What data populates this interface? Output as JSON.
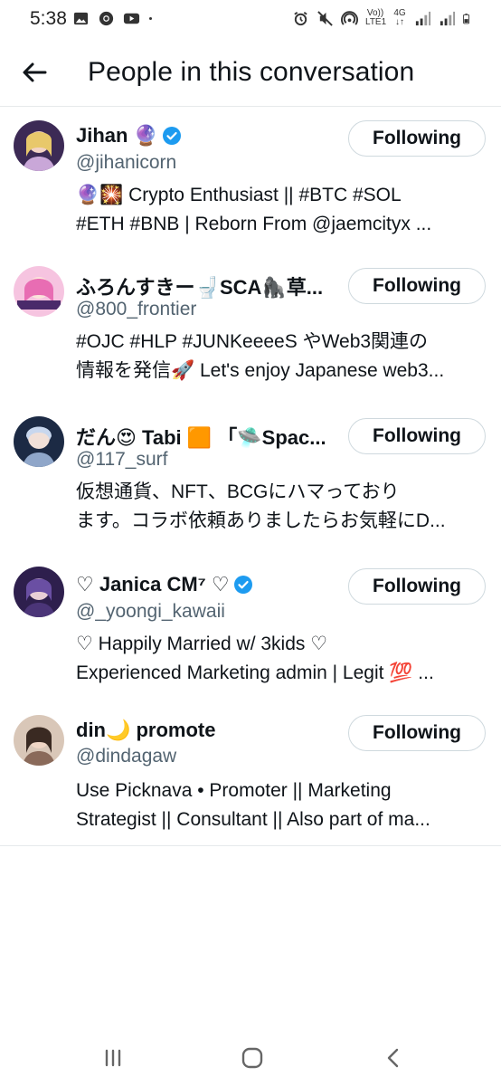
{
  "status_bar": {
    "time": "5:38",
    "left_icons": [
      "image-icon",
      "chrome-icon",
      "youtube-icon",
      "dot-icon"
    ],
    "right_icons": [
      "alarm-icon",
      "mute-icon",
      "hotspot-icon",
      "volte-icon",
      "4g-icon",
      "signal-icon",
      "signal-icon",
      "battery-icon"
    ],
    "volte_label": "Vo)) LTE1",
    "net_label": "4G"
  },
  "header": {
    "title": "People in this conversation"
  },
  "people": [
    {
      "name": "Jihan 🔮",
      "verified": true,
      "handle": "@jihanicorn",
      "bio_line1": "🔮🎇 Crypto Enthusiast || #BTC #SOL",
      "bio_line2": "#ETH #BNB | Reborn From @jaemcityx ...",
      "button": "Following",
      "avatar_color": "#c9a7d8"
    },
    {
      "name": "ふろんすきー🚽SCA🦍草...",
      "verified": false,
      "handle": "@800_frontier",
      "bio_line1": "#OJC #HLP #JUNKeeeeS やWeb3関連の",
      "bio_line2": "情報を発信🚀 Let's enjoy Japanese web3...",
      "button": "Following",
      "avatar_color": "#e86db3"
    },
    {
      "name": "だん😍 Tabi 🟧 「🛸Spac...",
      "verified": false,
      "handle": "@117_surf",
      "bio_line1": "仮想通貨、NFT、BCGにハマっており",
      "bio_line2": "ます。コラボ依頼ありましたらお気軽にD...",
      "button": "Following",
      "avatar_color": "#8fa6c9"
    },
    {
      "name": "♡ Janica CM⁷ ♡",
      "verified": true,
      "handle": "@_yoongi_kawaii",
      "bio_line1": "♡ Happily Married w/ 3kids ♡",
      "bio_line2": "Experienced Marketing admin | Legit 💯 ...",
      "button": "Following",
      "avatar_color": "#6a4fa3"
    },
    {
      "name": "din🌙 promote",
      "verified": false,
      "handle": "@dindagaw",
      "bio_line1": "Use Picknava • Promoter || Marketing",
      "bio_line2": "Strategist || Consultant || Also part of ma...",
      "button": "Following",
      "avatar_color": "#8a6a5a"
    }
  ],
  "colors": {
    "verified_blue": "#1d9bf0",
    "handle_gray": "#536471",
    "border": "#cfd9de"
  }
}
